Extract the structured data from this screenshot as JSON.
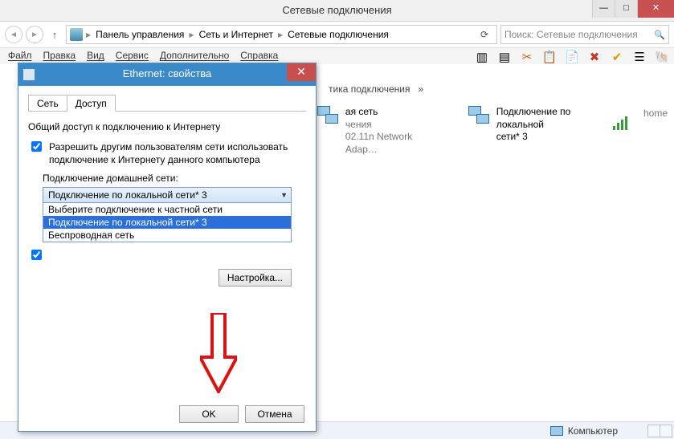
{
  "window": {
    "title": "Сетевые подключения",
    "controls": {
      "min": "—",
      "max": "□",
      "close": "✕"
    }
  },
  "nav": {
    "back": "◄",
    "forward": "►",
    "up": "↑",
    "refresh": "⟳",
    "breadcrumb": [
      "Панель управления",
      "Сеть и Интернет",
      "Сетевые подключения"
    ],
    "search_placeholder": "Поиск: Сетевые подключения"
  },
  "menu": {
    "file": "Файл",
    "edit": "Правка",
    "view": "Вид",
    "service": "Сервис",
    "more": "Дополнительно",
    "help": "Справка"
  },
  "toolbar_icons": {
    "organize": "organize-icon",
    "view": "view-icon",
    "cut": "cut-icon",
    "copy": "copy-icon",
    "paste": "paste-icon",
    "delete": "delete-icon",
    "check": "check-icon",
    "list": "list-icon",
    "shell": "shell-icon"
  },
  "strip": {
    "heading_fragment": "тика подключения",
    "chevron": "»",
    "item1": {
      "l1": "ая сеть",
      "l2": "чения",
      "l3": "02.11n Network Adap…"
    },
    "item2": {
      "l1": "Подключение по локальной",
      "l2": "сети* 3",
      "l3": "home"
    }
  },
  "statusbar": {
    "label": "Компьютер"
  },
  "dialog": {
    "title": "Ethernet: свойства",
    "close": "✕",
    "tabs": {
      "network": "Сеть",
      "access": "Доступ"
    },
    "section": "Общий доступ к подключению к Интернету",
    "chk1": "Разрешить другим пользователям сети использовать подключение к Интернету данного компьютера",
    "home_label": "Подключение домашней сети:",
    "combo_selected": "Подключение по локальной сети* 3",
    "options": [
      "Выберите подключение к частной сети",
      "Подключение по локальной сети* 3",
      "Беспроводная сеть"
    ],
    "config_btn": "Настройка...",
    "ok": "OK",
    "cancel": "Отмена"
  }
}
